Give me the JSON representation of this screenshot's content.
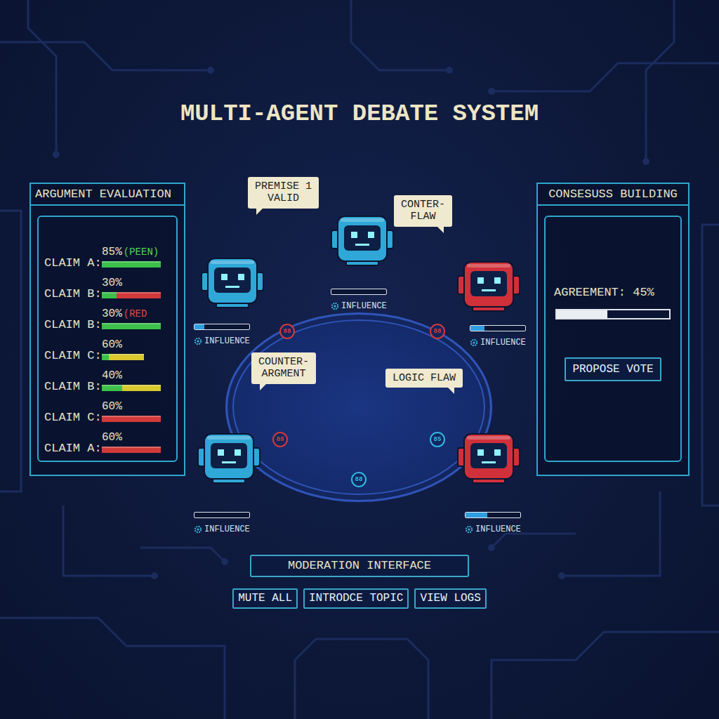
{
  "title": "MULTI-AGENT DEBATE SYSTEM",
  "argument_panel": {
    "title": "ARGUMENT EVALUATION",
    "claims": [
      {
        "label": "CLAIM A:",
        "value": "85%",
        "tag": "(PEEN)",
        "tag_color": "#4fd65a",
        "segments": [
          {
            "level": 1,
            "color": "#3cc04a"
          }
        ]
      },
      {
        "label": "CLAIM B:",
        "value": "30%",
        "segments": [
          {
            "level": 0.25,
            "color": "#3cc04a"
          },
          {
            "level": 0.75,
            "color": "#d23a3a"
          }
        ]
      },
      {
        "label": "CLAIM B:",
        "value": "30%",
        "tag": "(RED",
        "tag_color": "#e04848",
        "segments": [
          {
            "level": 1,
            "color": "#3cc04a"
          }
        ]
      },
      {
        "label": "CLAIM C:",
        "value": "60%",
        "segments": [
          {
            "level": 0.12,
            "color": "#3cc04a"
          },
          {
            "level": 0.6,
            "color": "#d9c82e"
          }
        ]
      },
      {
        "label": "CLAIM B:",
        "value": "40%",
        "segments": [
          {
            "level": 0.35,
            "color": "#3cc04a"
          },
          {
            "level": 0.65,
            "color": "#d9c82e"
          }
        ]
      },
      {
        "label": "CLAIM C:",
        "value": "60%",
        "segments": [
          {
            "level": 1,
            "color": "#d23a3a"
          }
        ]
      },
      {
        "label": "CLAIM A:",
        "value": "60%",
        "segments": [
          {
            "level": 1,
            "color": "#d23a3a"
          }
        ]
      }
    ]
  },
  "consensus_panel": {
    "title": "CONSESUSS BUILDING",
    "agreement": "AGREEMENT: 45%",
    "level": 0.45,
    "button": "PROPOSE VOTE"
  },
  "debate": {
    "agents": [
      {
        "color": "#2fa8d8",
        "influence": 0.18,
        "influence_label": "INFLUENCE"
      },
      {
        "color": "#2fa8d8",
        "influence": 0,
        "influence_label": "INFLUENCE"
      },
      {
        "color": "#d0303a",
        "influence": 0.25,
        "influence_label": "INFLUENCE"
      },
      {
        "color": "#2fa8d8",
        "influence": 0,
        "influence_label": "INFLUENCE"
      },
      {
        "color": "#d0303a",
        "influence": 0.4,
        "influence_label": "INFLUENCE"
      }
    ],
    "bubbles": [
      {
        "lines": [
          "PREMISE 1",
          "VALID"
        ]
      },
      {
        "lines": [
          "CONTER-",
          "FLAW"
        ]
      },
      {
        "lines": [
          "COUNTER-",
          "ARGMENT"
        ]
      },
      {
        "lines": [
          "LOGIC FLAW"
        ]
      }
    ],
    "chips": [
      {
        "label": "88",
        "color": "#d23a3a"
      },
      {
        "label": "88",
        "color": "#d23a3a"
      },
      {
        "label": "88",
        "color": "#d23a3a"
      },
      {
        "label": "85",
        "color": "#2fb8e0"
      },
      {
        "label": "88",
        "color": "#2fb8e0"
      }
    ]
  },
  "moderation": {
    "title": "MODERATION INTERFACE",
    "buttons": [
      "MUTE ALL",
      "INTRODCE TOPIC",
      "VIEW LOGS"
    ]
  }
}
